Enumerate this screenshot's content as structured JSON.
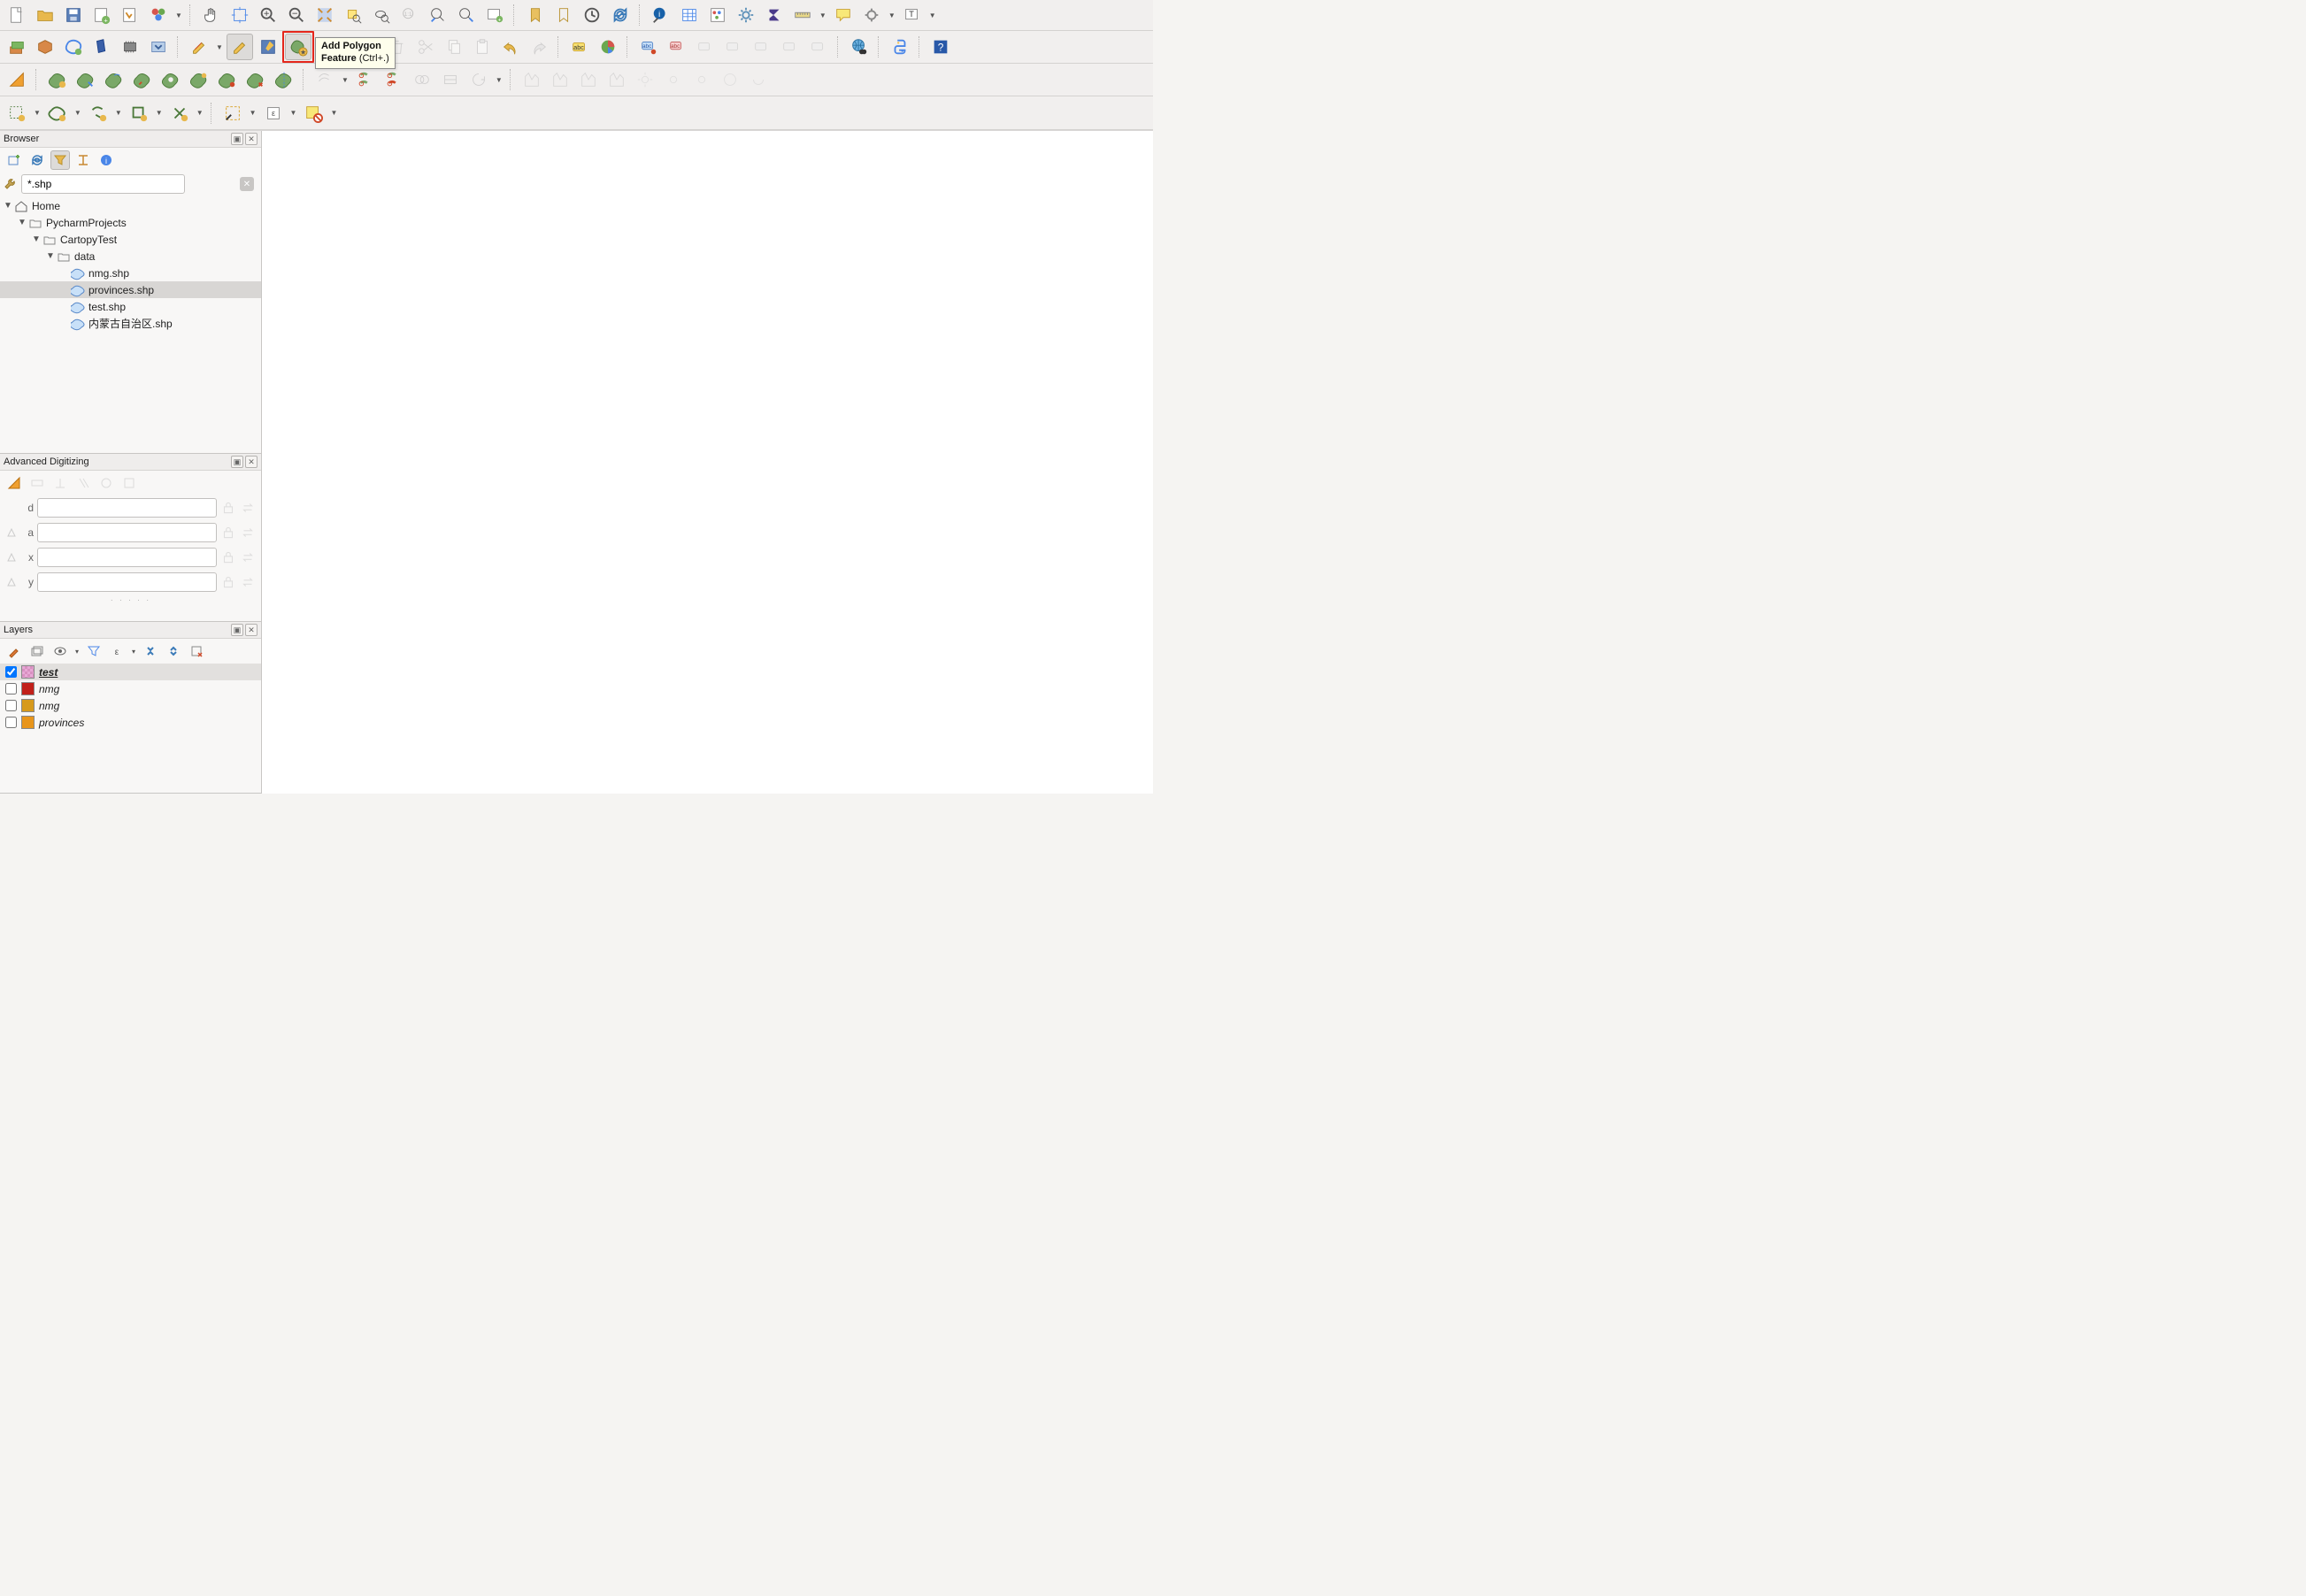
{
  "tooltip": {
    "title": "Add Polygon",
    "line2a": "Feature",
    "shortcut": "(Ctrl+.)"
  },
  "panels": {
    "browser": {
      "title": "Browser"
    },
    "adv": {
      "title": "Advanced Digitizing"
    },
    "layers": {
      "title": "Layers"
    }
  },
  "browser": {
    "filter_value": "*.shp",
    "tree": {
      "home": "Home",
      "n1": "PycharmProjects",
      "n2": "CartopyTest",
      "n3": "data",
      "files": [
        "nmg.shp",
        "provinces.shp",
        "test.shp",
        "内蒙古自治区.shp"
      ],
      "selected_index": 1
    }
  },
  "adv": {
    "fields": [
      {
        "label": "d"
      },
      {
        "label": "a"
      },
      {
        "label": "x"
      },
      {
        "label": "y"
      }
    ]
  },
  "layers": {
    "items": [
      {
        "name": "test",
        "checked": true,
        "color": "#e7a8d6",
        "editing": true
      },
      {
        "name": "nmg",
        "checked": false,
        "color": "#c1201a",
        "editing": false
      },
      {
        "name": "nmg",
        "checked": false,
        "color": "#d79a1c",
        "editing": false
      },
      {
        "name": "provinces",
        "checked": false,
        "color": "#e8951b",
        "editing": false
      }
    ]
  },
  "icons": {
    "new": "new-file",
    "open": "open-folder",
    "save": "save-disk",
    "saveas": "save-as",
    "print": "print-layout",
    "style": "style-manager"
  }
}
